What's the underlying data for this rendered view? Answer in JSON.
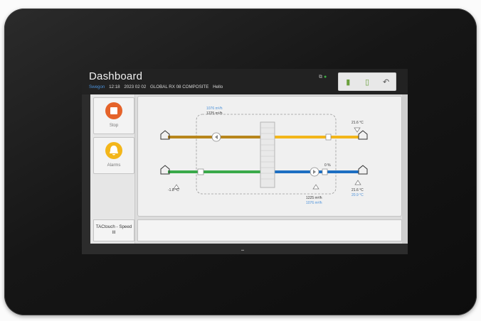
{
  "header": {
    "title": "Dashboard",
    "brand": "Swegon",
    "time": "12:18",
    "date": "2023 02 02",
    "unit_name": "GLOBAL RX 08 COMPOSITE",
    "greeting": "Hello"
  },
  "status_icons": {
    "network": "network-icon",
    "status": "ok-status-icon"
  },
  "toolbar": {
    "icons": [
      "fan-speed-icon",
      "door-icon",
      "exit-icon"
    ]
  },
  "left_panel": {
    "stop_label": "Stop",
    "alarms_label": "Alarms",
    "speed_label": "TACtouch - Speed III"
  },
  "diagram": {
    "supply_flow_top": "1076 m³/h",
    "supply_flow_top2": "1225 m³/h",
    "supply_temp": "21.6 °C",
    "outdoor_temp": "-1.8 °C",
    "extract_temp": "21.6 °C",
    "extract_temp_alt": "20.9 °C",
    "extract_flow": "1225 m³/h",
    "extract_flow2": "1076 m³/h",
    "damper_percent": "0 %"
  },
  "colors": {
    "supply_warm": "#f3b61a",
    "supply_cold": "#3aaa4a",
    "extract_warm": "#b8861c",
    "extract_cold": "#1d6fc2",
    "stop": "#e5632a",
    "alarm": "#f3b61a"
  }
}
